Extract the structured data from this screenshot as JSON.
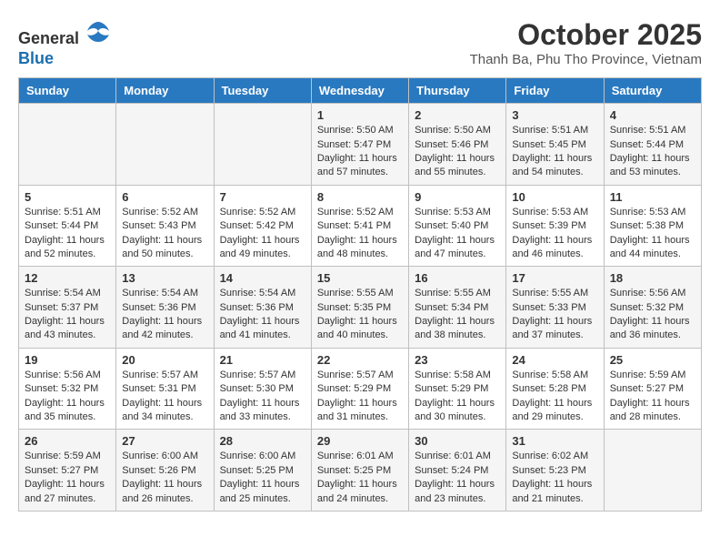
{
  "header": {
    "logo_line1": "General",
    "logo_line2": "Blue",
    "month": "October 2025",
    "location": "Thanh Ba, Phu Tho Province, Vietnam"
  },
  "weekdays": [
    "Sunday",
    "Monday",
    "Tuesday",
    "Wednesday",
    "Thursday",
    "Friday",
    "Saturday"
  ],
  "weeks": [
    [
      {
        "day": "",
        "info": ""
      },
      {
        "day": "",
        "info": ""
      },
      {
        "day": "",
        "info": ""
      },
      {
        "day": "1",
        "info": "Sunrise: 5:50 AM\nSunset: 5:47 PM\nDaylight: 11 hours\nand 57 minutes."
      },
      {
        "day": "2",
        "info": "Sunrise: 5:50 AM\nSunset: 5:46 PM\nDaylight: 11 hours\nand 55 minutes."
      },
      {
        "day": "3",
        "info": "Sunrise: 5:51 AM\nSunset: 5:45 PM\nDaylight: 11 hours\nand 54 minutes."
      },
      {
        "day": "4",
        "info": "Sunrise: 5:51 AM\nSunset: 5:44 PM\nDaylight: 11 hours\nand 53 minutes."
      }
    ],
    [
      {
        "day": "5",
        "info": "Sunrise: 5:51 AM\nSunset: 5:44 PM\nDaylight: 11 hours\nand 52 minutes."
      },
      {
        "day": "6",
        "info": "Sunrise: 5:52 AM\nSunset: 5:43 PM\nDaylight: 11 hours\nand 50 minutes."
      },
      {
        "day": "7",
        "info": "Sunrise: 5:52 AM\nSunset: 5:42 PM\nDaylight: 11 hours\nand 49 minutes."
      },
      {
        "day": "8",
        "info": "Sunrise: 5:52 AM\nSunset: 5:41 PM\nDaylight: 11 hours\nand 48 minutes."
      },
      {
        "day": "9",
        "info": "Sunrise: 5:53 AM\nSunset: 5:40 PM\nDaylight: 11 hours\nand 47 minutes."
      },
      {
        "day": "10",
        "info": "Sunrise: 5:53 AM\nSunset: 5:39 PM\nDaylight: 11 hours\nand 46 minutes."
      },
      {
        "day": "11",
        "info": "Sunrise: 5:53 AM\nSunset: 5:38 PM\nDaylight: 11 hours\nand 44 minutes."
      }
    ],
    [
      {
        "day": "12",
        "info": "Sunrise: 5:54 AM\nSunset: 5:37 PM\nDaylight: 11 hours\nand 43 minutes."
      },
      {
        "day": "13",
        "info": "Sunrise: 5:54 AM\nSunset: 5:36 PM\nDaylight: 11 hours\nand 42 minutes."
      },
      {
        "day": "14",
        "info": "Sunrise: 5:54 AM\nSunset: 5:36 PM\nDaylight: 11 hours\nand 41 minutes."
      },
      {
        "day": "15",
        "info": "Sunrise: 5:55 AM\nSunset: 5:35 PM\nDaylight: 11 hours\nand 40 minutes."
      },
      {
        "day": "16",
        "info": "Sunrise: 5:55 AM\nSunset: 5:34 PM\nDaylight: 11 hours\nand 38 minutes."
      },
      {
        "day": "17",
        "info": "Sunrise: 5:55 AM\nSunset: 5:33 PM\nDaylight: 11 hours\nand 37 minutes."
      },
      {
        "day": "18",
        "info": "Sunrise: 5:56 AM\nSunset: 5:32 PM\nDaylight: 11 hours\nand 36 minutes."
      }
    ],
    [
      {
        "day": "19",
        "info": "Sunrise: 5:56 AM\nSunset: 5:32 PM\nDaylight: 11 hours\nand 35 minutes."
      },
      {
        "day": "20",
        "info": "Sunrise: 5:57 AM\nSunset: 5:31 PM\nDaylight: 11 hours\nand 34 minutes."
      },
      {
        "day": "21",
        "info": "Sunrise: 5:57 AM\nSunset: 5:30 PM\nDaylight: 11 hours\nand 33 minutes."
      },
      {
        "day": "22",
        "info": "Sunrise: 5:57 AM\nSunset: 5:29 PM\nDaylight: 11 hours\nand 31 minutes."
      },
      {
        "day": "23",
        "info": "Sunrise: 5:58 AM\nSunset: 5:29 PM\nDaylight: 11 hours\nand 30 minutes."
      },
      {
        "day": "24",
        "info": "Sunrise: 5:58 AM\nSunset: 5:28 PM\nDaylight: 11 hours\nand 29 minutes."
      },
      {
        "day": "25",
        "info": "Sunrise: 5:59 AM\nSunset: 5:27 PM\nDaylight: 11 hours\nand 28 minutes."
      }
    ],
    [
      {
        "day": "26",
        "info": "Sunrise: 5:59 AM\nSunset: 5:27 PM\nDaylight: 11 hours\nand 27 minutes."
      },
      {
        "day": "27",
        "info": "Sunrise: 6:00 AM\nSunset: 5:26 PM\nDaylight: 11 hours\nand 26 minutes."
      },
      {
        "day": "28",
        "info": "Sunrise: 6:00 AM\nSunset: 5:25 PM\nDaylight: 11 hours\nand 25 minutes."
      },
      {
        "day": "29",
        "info": "Sunrise: 6:01 AM\nSunset: 5:25 PM\nDaylight: 11 hours\nand 24 minutes."
      },
      {
        "day": "30",
        "info": "Sunrise: 6:01 AM\nSunset: 5:24 PM\nDaylight: 11 hours\nand 23 minutes."
      },
      {
        "day": "31",
        "info": "Sunrise: 6:02 AM\nSunset: 5:23 PM\nDaylight: 11 hours\nand 21 minutes."
      },
      {
        "day": "",
        "info": ""
      }
    ]
  ]
}
